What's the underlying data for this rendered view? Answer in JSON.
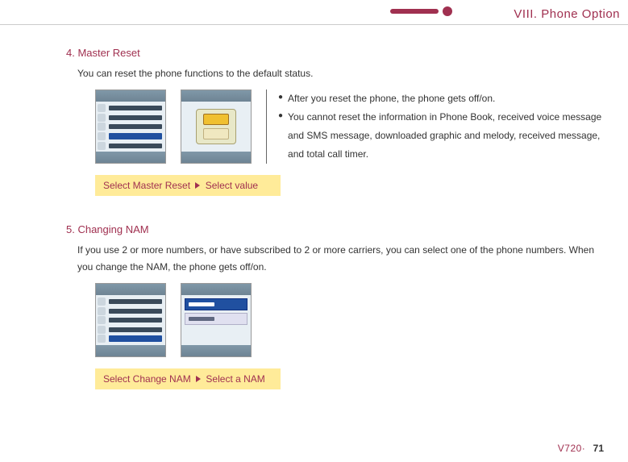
{
  "chapter": "VIII. Phone Option",
  "section4": {
    "title": "4. Master Reset",
    "intro": "You can reset the phone functions to the default status.",
    "bullets": [
      "After you reset the phone, the phone gets off/on.",
      "You cannot reset the information in Phone Book, received voice message and SMS message, downloaded graphic and melody, received message, and total call timer."
    ],
    "caption_a": "Select Master Reset",
    "caption_b": "Select value"
  },
  "section5": {
    "title": "5. Changing NAM",
    "intro": "If you use 2 or more numbers, or have subscribed to 2 or more carriers, you can select one of the phone numbers. When you change the NAM, the phone gets off/on.",
    "caption_a": "Select Change NAM",
    "caption_b": "Select a NAM"
  },
  "footer": {
    "model": "V720·",
    "page": "71"
  }
}
